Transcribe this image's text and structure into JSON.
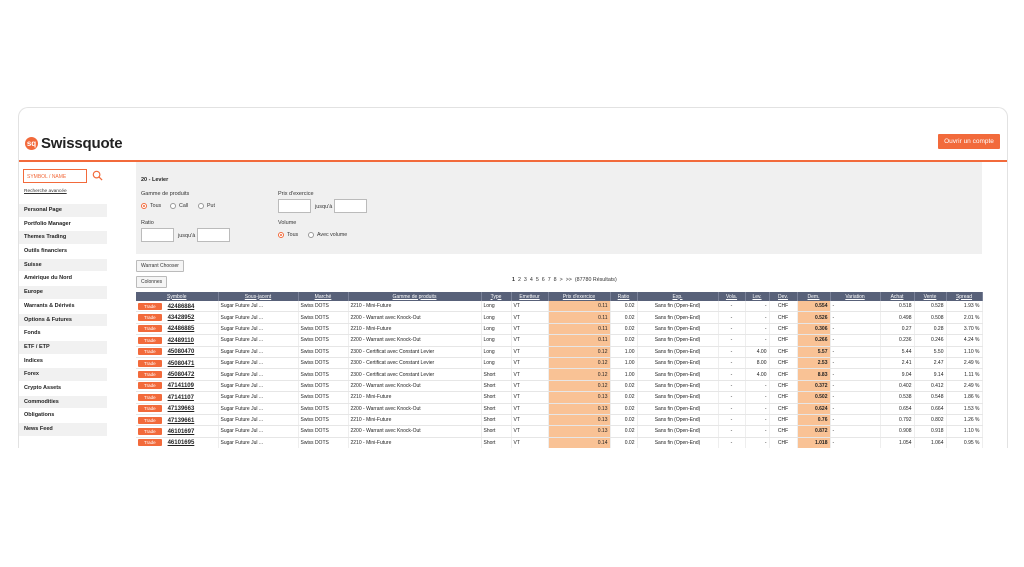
{
  "header": {
    "logo_text": "Swissquote",
    "logo_mark": "sq",
    "open_account_label": "Ouvrir un compte"
  },
  "sidebar": {
    "search_placeholder": "SYMBOL / NAME",
    "advanced_search": "Recherche avancée",
    "items": [
      "Personal Page",
      "Portfolio Manager",
      "Themes Trading",
      "Outils financiers",
      "Suisse",
      "Amérique du Nord",
      "Europe",
      "Warrants & Dérivés",
      "Options & Futures",
      "Fonds",
      "ETF / ETP",
      "Indices",
      "Forex",
      "Crypto Assets",
      "Commodities",
      "Obligations",
      "News Feed"
    ]
  },
  "filter": {
    "title": "20 - Levier",
    "gamme_label": "Gamme de produits",
    "gamme_options": [
      "Tous",
      "Call",
      "Put"
    ],
    "prix_label": "Prix d'exercice",
    "jusqua": "jusqu'à",
    "ratio_label": "Ratio",
    "volume_label": "Volume",
    "volume_options": [
      "Tous",
      "Avec volume"
    ]
  },
  "buttons": {
    "warrant_chooser": "Warrant Chooser",
    "colonnes": "Colonnes"
  },
  "pager": {
    "pages": [
      "1",
      "2",
      "3",
      "4",
      "5",
      "6",
      "7",
      "8",
      ">",
      ">>"
    ],
    "results": "(87780 Résultats)"
  },
  "table": {
    "headers": [
      "Symbole",
      "Sous-jacent",
      "Marché",
      "Gamme de produits",
      "Type",
      "Emetteur",
      "Prix d'exercice",
      "Ratio",
      "Exp.",
      "Vola.",
      "Lev.",
      "Dev.",
      "Dem.",
      "Variation",
      "Achat",
      "Vente",
      "Spread"
    ],
    "trade_label": "Trade",
    "rows": [
      [
        "42486884",
        "Sugar Future Jul ...",
        "Swiss DOTS",
        "2210 - Mini-Future",
        "Long",
        "VT",
        "0.11",
        "0.02",
        "Sans fin (Open-End)",
        "-",
        "-",
        "CHF",
        "0.554",
        "-",
        "0.518",
        "0.528",
        "1.93 %"
      ],
      [
        "43428952",
        "Sugar Future Jul ...",
        "Swiss DOTS",
        "2200 - Warrant avec Knock-Out",
        "Long",
        "VT",
        "0.11",
        "0.02",
        "Sans fin (Open-End)",
        "-",
        "-",
        "CHF",
        "0.526",
        "-",
        "0.498",
        "0.508",
        "2.01 %"
      ],
      [
        "42486885",
        "Sugar Future Jul ...",
        "Swiss DOTS",
        "2210 - Mini-Future",
        "Long",
        "VT",
        "0.11",
        "0.02",
        "Sans fin (Open-End)",
        "-",
        "-",
        "CHF",
        "0.306",
        "-",
        "0.27",
        "0.28",
        "3.70 %"
      ],
      [
        "42489110",
        "Sugar Future Jul ...",
        "Swiss DOTS",
        "2200 - Warrant avec Knock-Out",
        "Long",
        "VT",
        "0.11",
        "0.02",
        "Sans fin (Open-End)",
        "-",
        "-",
        "CHF",
        "0.266",
        "-",
        "0.236",
        "0.246",
        "4.24 %"
      ],
      [
        "45080470",
        "Sugar Future Jul ...",
        "Swiss DOTS",
        "2300 - Certificat avec Constant Levier",
        "Long",
        "VT",
        "0.12",
        "1.00",
        "Sans fin (Open-End)",
        "-",
        "4.00",
        "CHF",
        "5.57",
        "-",
        "5.44",
        "5.50",
        "1.10 %"
      ],
      [
        "45080471",
        "Sugar Future Jul ...",
        "Swiss DOTS",
        "2300 - Certificat avec Constant Levier",
        "Long",
        "VT",
        "0.12",
        "1.00",
        "Sans fin (Open-End)",
        "-",
        "8.00",
        "CHF",
        "2.53",
        "-",
        "2.41",
        "2.47",
        "2.49 %"
      ],
      [
        "45080472",
        "Sugar Future Jul ...",
        "Swiss DOTS",
        "2300 - Certificat avec Constant Levier",
        "Short",
        "VT",
        "0.12",
        "1.00",
        "Sans fin (Open-End)",
        "-",
        "4.00",
        "CHF",
        "8.83",
        "-",
        "9.04",
        "9.14",
        "1.11 %"
      ],
      [
        "47141109",
        "Sugar Future Jul ...",
        "Swiss DOTS",
        "2200 - Warrant avec Knock-Out",
        "Short",
        "VT",
        "0.12",
        "0.02",
        "Sans fin (Open-End)",
        "-",
        "-",
        "CHF",
        "0.372",
        "-",
        "0.402",
        "0.412",
        "2.49 %"
      ],
      [
        "47141107",
        "Sugar Future Jul ...",
        "Swiss DOTS",
        "2210 - Mini-Future",
        "Short",
        "VT",
        "0.13",
        "0.02",
        "Sans fin (Open-End)",
        "-",
        "-",
        "CHF",
        "0.502",
        "-",
        "0.538",
        "0.548",
        "1.86 %"
      ],
      [
        "47139663",
        "Sugar Future Jul ...",
        "Swiss DOTS",
        "2200 - Warrant avec Knock-Out",
        "Short",
        "VT",
        "0.13",
        "0.02",
        "Sans fin (Open-End)",
        "-",
        "-",
        "CHF",
        "0.624",
        "-",
        "0.654",
        "0.664",
        "1.53 %"
      ],
      [
        "47139661",
        "Sugar Future Jul ...",
        "Swiss DOTS",
        "2210 - Mini-Future",
        "Short",
        "VT",
        "0.13",
        "0.02",
        "Sans fin (Open-End)",
        "-",
        "-",
        "CHF",
        "0.76",
        "-",
        "0.792",
        "0.802",
        "1.26 %"
      ],
      [
        "46101697",
        "Sugar Future Jul ...",
        "Swiss DOTS",
        "2200 - Warrant avec Knock-Out",
        "Short",
        "VT",
        "0.13",
        "0.02",
        "Sans fin (Open-End)",
        "-",
        "-",
        "CHF",
        "0.872",
        "-",
        "0.908",
        "0.918",
        "1.10 %"
      ],
      [
        "46101695",
        "Sugar Future Jul ...",
        "Swiss DOTS",
        "2210 - Mini-Future",
        "Short",
        "VT",
        "0.14",
        "0.02",
        "Sans fin (Open-End)",
        "-",
        "-",
        "CHF",
        "1.018",
        "-",
        "1.054",
        "1.064",
        "0.95 %"
      ]
    ]
  }
}
